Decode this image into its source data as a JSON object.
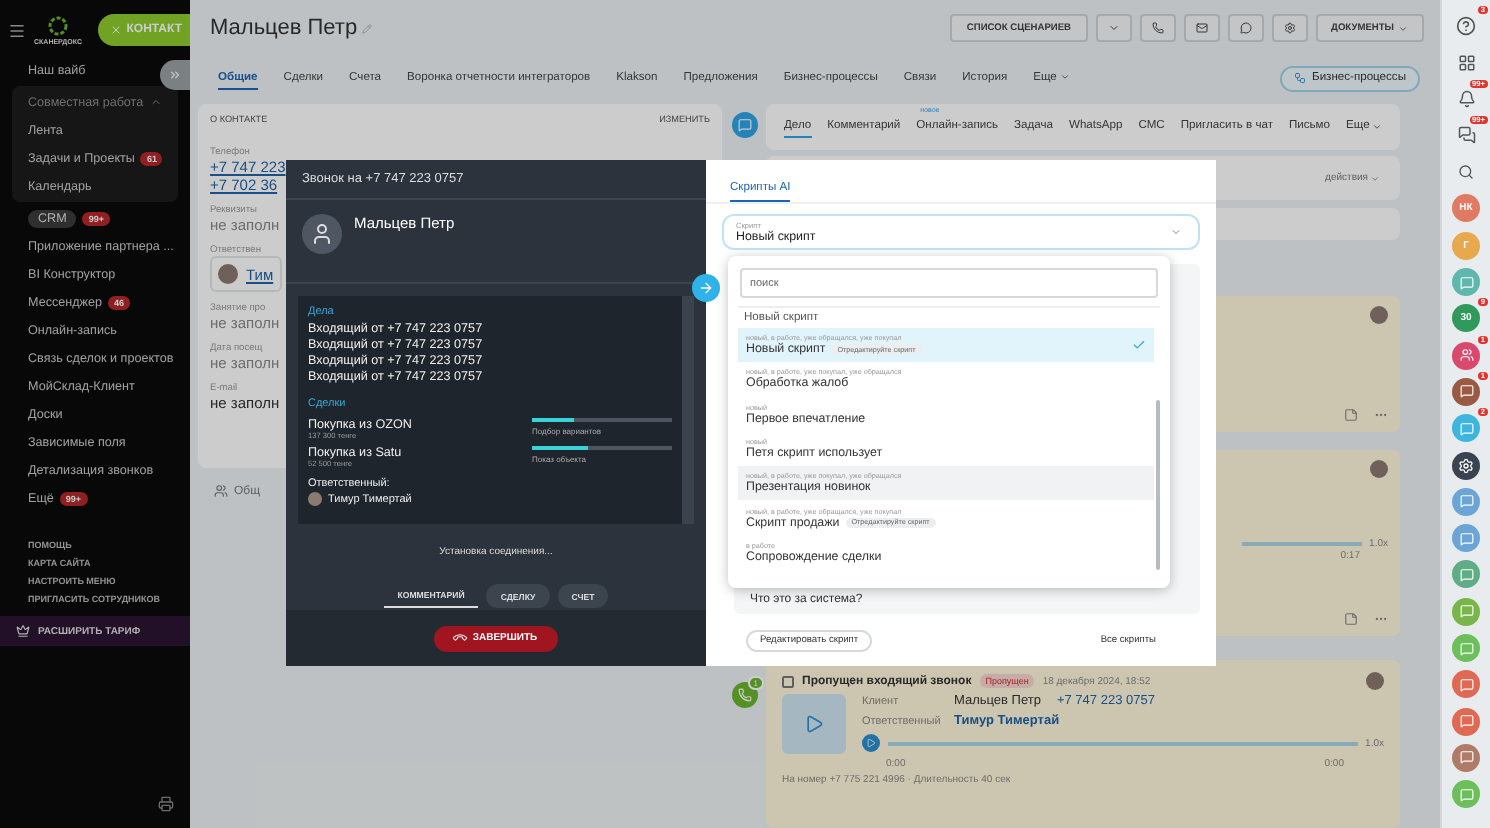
{
  "sidebar": {
    "logo": "СКАНЕРДОКС",
    "add_button": "КОНТАКТ",
    "items": [
      {
        "kind": "item",
        "label": "Наш вайб"
      },
      {
        "kind": "group",
        "label": "Совместная работа",
        "expanded": true,
        "children": [
          {
            "kind": "item",
            "label": "Лента"
          },
          {
            "kind": "item",
            "label": "Задачи и Проекты",
            "badge": "61"
          },
          {
            "kind": "item",
            "label": "Календарь"
          }
        ]
      },
      {
        "kind": "pill",
        "label": "CRM",
        "badge": "99+"
      },
      {
        "kind": "item",
        "label": "Приложение партнера ..."
      },
      {
        "kind": "item",
        "label": "BI Конструктор"
      },
      {
        "kind": "item",
        "label": "Мессенджер",
        "badge": "46"
      },
      {
        "kind": "item",
        "label": "Онлайн-запись"
      },
      {
        "kind": "item",
        "label": "Связь сделок и проектов"
      },
      {
        "kind": "item",
        "label": "МойСклад-Клиент"
      },
      {
        "kind": "item",
        "label": "Доски"
      },
      {
        "kind": "item",
        "label": "Зависимые поля"
      },
      {
        "kind": "item",
        "label": "Детализация звонков"
      },
      {
        "kind": "item",
        "label": "Ещё",
        "badge": "99+"
      }
    ],
    "links": [
      "ПОМОЩЬ",
      "КАРТА САЙТА",
      "НАСТРОИТЬ МЕНЮ",
      "ПРИГЛАСИТЬ СОТРУДНИКОВ"
    ],
    "upgrade": "РАСШИРИТЬ ТАРИФ"
  },
  "header": {
    "title": "Мальцев Петр",
    "scenarios_button": "СПИСОК СЦЕНАРИЕВ",
    "documents_button": "ДОКУМЕНТЫ"
  },
  "tabs": [
    {
      "label": "Общие",
      "selected": true
    },
    {
      "label": "Сделки",
      "selected": false
    },
    {
      "label": "Счета",
      "selected": false
    },
    {
      "label": "Воронка отчетности интеграторов",
      "selected": false
    },
    {
      "label": "Klakson",
      "selected": false
    },
    {
      "label": "Предложения",
      "selected": false
    },
    {
      "label": "Бизнес-процессы",
      "selected": false
    },
    {
      "label": "Связи",
      "selected": false
    },
    {
      "label": "История",
      "selected": false
    },
    {
      "label": "Еще",
      "selected": false
    }
  ],
  "bp_button": "Бизнес-процессы",
  "contact_card": {
    "title": "О КОНТАКТЕ",
    "edit": "ИЗМЕНИТЬ",
    "fields": [
      {
        "label": "Телефон",
        "kind": "phones",
        "values": [
          "+7 747 223",
          "+7 702 36"
        ]
      },
      {
        "label": "Реквизиты",
        "kind": "text",
        "values": [
          "не заполн"
        ]
      },
      {
        "label": "Ответствен",
        "kind": "person",
        "values": [
          "Тим"
        ]
      },
      {
        "label": "Занятие про",
        "kind": "text",
        "values": [
          "не заполн"
        ]
      },
      {
        "label": "Дата посещ",
        "kind": "text",
        "values": [
          "не заполн"
        ]
      },
      {
        "label": "E-mail",
        "kind": "strong",
        "values": [
          "не заполн"
        ]
      }
    ],
    "footer": "Общ"
  },
  "activity_tabs": [
    {
      "label": "Дело",
      "selected": true
    },
    {
      "label": "Комментарий",
      "selected": false
    },
    {
      "label": "Онлайн-запись",
      "selected": false,
      "note": "новое"
    },
    {
      "label": "Задача",
      "selected": false
    },
    {
      "label": "WhatsApp",
      "selected": false
    },
    {
      "label": "СМС",
      "selected": false
    },
    {
      "label": "Пригласить в чат",
      "selected": false
    },
    {
      "label": "Письмо",
      "selected": false
    },
    {
      "label": "Еще",
      "selected": false
    }
  ],
  "actions": "действия",
  "timeline": [
    {
      "kind": "note"
    },
    {
      "kind": "audio",
      "speed": "1.0x",
      "time": "0:17"
    }
  ],
  "missed_call": {
    "count": "1",
    "checked": false,
    "title": "Пропущен входящий звонок",
    "badge": "Пропущен",
    "date": "18 декабря 2024, 18:52",
    "fields": [
      {
        "label": "Клиент",
        "name": "Мальцев Петр",
        "phone": "+7 747 223 0757"
      },
      {
        "label": "Ответственный",
        "name": "Тимур Тимертай"
      }
    ],
    "speed": "1.0x",
    "start": "0:00",
    "end": "0:00",
    "footer": "На номер +7 775 221 4996 · Длительность 40 сек"
  },
  "call": {
    "title": "Звонок на +7 747 223 0757",
    "contact": "Мальцев Петр",
    "deals_title": "Дела",
    "deals": [
      "Входящий от +7 747 223 0757",
      "Входящий от +7 747 223 0757",
      "Входящий от +7 747 223 0757",
      "Входящий от +7 747 223 0757"
    ],
    "sales_title": "Сделки",
    "sales": [
      {
        "name": "Покупка из OZON",
        "amount": "137 300 тенге",
        "stage": "Подбор вариантов",
        "level": 0.3
      },
      {
        "name": "Покупка из Satu",
        "amount": "52 500 тенге",
        "stage": "Показ объекта",
        "level": 0.4
      }
    ],
    "responsible_title": "Ответственный:",
    "responsible": "Тимур Тимертай",
    "status": "Установка соединения...",
    "tabs": [
      {
        "label": "КОММЕНТАРИЙ",
        "selected": true
      },
      {
        "label": "СДЕЛКУ",
        "selected": false
      },
      {
        "label": "СЧЕТ",
        "selected": false
      }
    ],
    "end_button": "ЗАВЕРШИТЬ"
  },
  "scripts": {
    "tab": "Скрипты AI",
    "select_label": "Скрипт",
    "select_value": "Новый скрипт",
    "search_placeholder": "поиск",
    "group_label": "Новый скрипт",
    "options": [
      {
        "tags": "новый, в работе, уже обращался, уже покупал",
        "name": "Новый скрипт",
        "badge": "Отредактируйте скрипт",
        "selected": true,
        "highlighted": false
      },
      {
        "tags": "новый, в работе, уже покупал, уже обращался",
        "name": "Обработка жалоб",
        "selected": false,
        "highlighted": false
      },
      {
        "tags": "новый",
        "name": "Первое впечатление",
        "selected": false,
        "highlighted": false
      },
      {
        "tags": "новый",
        "name": "Петя скрипт использует",
        "selected": false,
        "highlighted": false
      },
      {
        "tags": "новый, в работе, уже покупал, уже обращался",
        "name": "Презентация новинок",
        "selected": false,
        "highlighted": true
      },
      {
        "tags": "новый, в работе, уже обращался, уже покупал",
        "name": "Скрипт продажи",
        "badge": "Отредактируйте скрипт",
        "selected": false,
        "highlighted": false
      },
      {
        "tags": "в работе",
        "name": "Сопровождение сделки",
        "selected": false,
        "highlighted": false
      }
    ],
    "question": "Что это за система?",
    "edit_button": "Редактировать скрипт",
    "all_link": "Все скрипты"
  },
  "rail": [
    {
      "kind": "help",
      "badge": "3"
    },
    {
      "kind": "apps"
    },
    {
      "kind": "bell",
      "badge": "99+"
    },
    {
      "kind": "chat",
      "badge": "99+"
    },
    {
      "kind": "search"
    },
    {
      "kind": "avatar",
      "text": "НК",
      "color": "#e07a62"
    },
    {
      "kind": "avatar",
      "text": "Г",
      "color": "#e7a84e"
    },
    {
      "kind": "chat-avatar",
      "color": "#5fb7ae"
    },
    {
      "kind": "avatar",
      "text": "30",
      "color": "#2f9a5b",
      "badge": "9"
    },
    {
      "kind": "people-avatar",
      "color": "#d8496d",
      "badge": "1"
    },
    {
      "kind": "chat-avatar",
      "color": "#9a5942",
      "badge": "1"
    },
    {
      "kind": "chat-avatar",
      "color": "#3db5df",
      "badge": "2"
    },
    {
      "kind": "gear-avatar",
      "color": "#3a4350"
    },
    {
      "kind": "chat-avatar",
      "color": "#6aa5d5"
    },
    {
      "kind": "chat-avatar",
      "color": "#6aa5d5"
    },
    {
      "kind": "chat-avatar",
      "color": "#5fad86"
    },
    {
      "kind": "chat-avatar",
      "color": "#79b548"
    },
    {
      "kind": "chat-avatar",
      "color": "#6cbf5a"
    },
    {
      "kind": "chat-avatar",
      "color": "#e06954"
    },
    {
      "kind": "chat-avatar",
      "color": "#e06954"
    },
    {
      "kind": "chat-avatar",
      "color": "#b07a68"
    },
    {
      "kind": "chat-avatar",
      "color": "#6cbf5a"
    }
  ]
}
